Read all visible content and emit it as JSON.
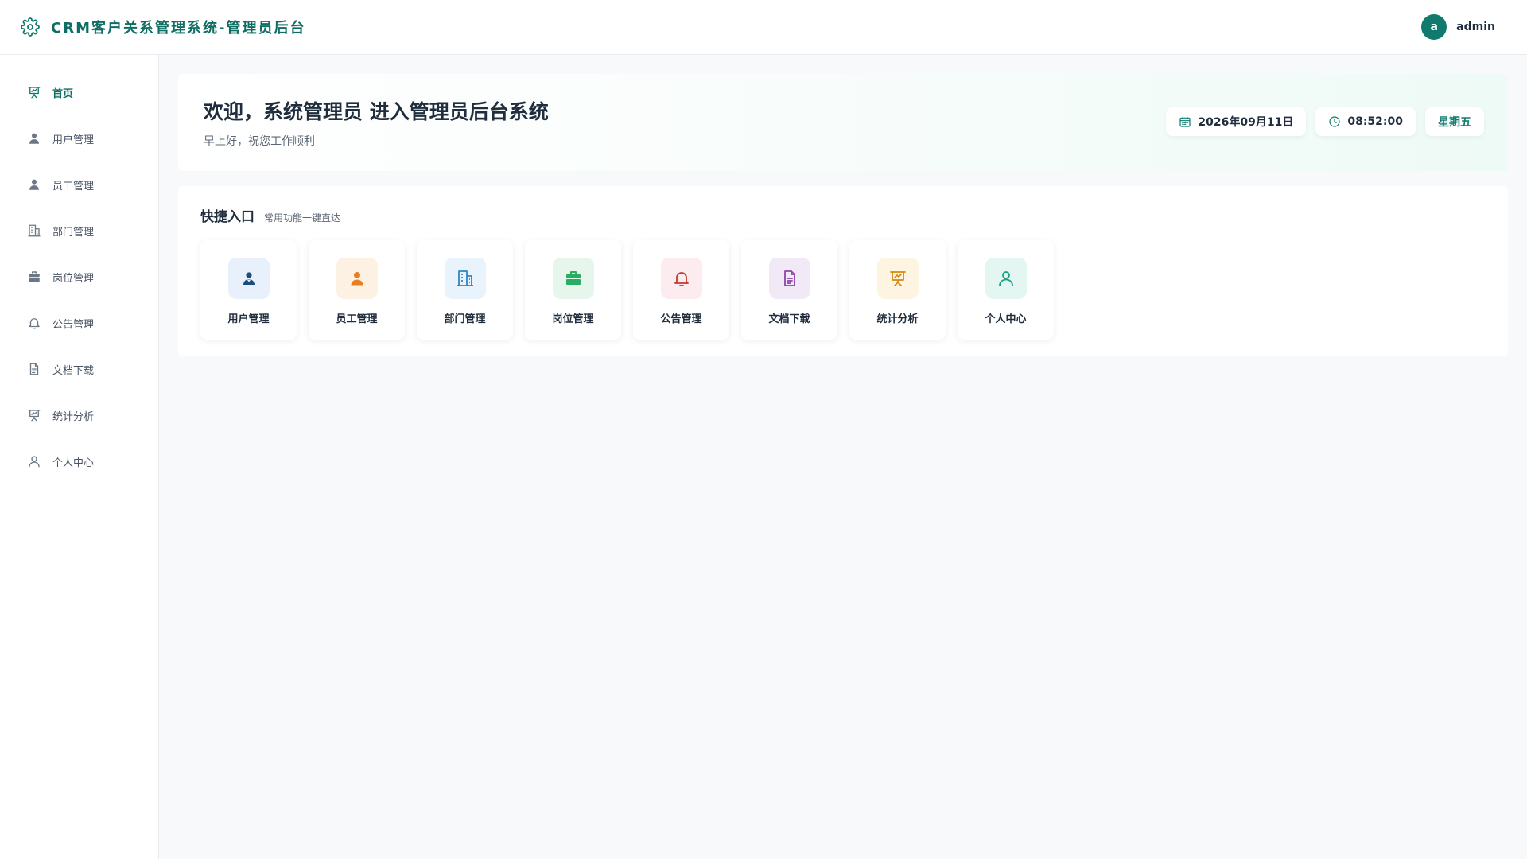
{
  "header": {
    "title": "CRM客户关系管理系统-管理员后台",
    "brand_icon": "gear-icon",
    "user": {
      "avatar_letter": "a",
      "name": "admin"
    }
  },
  "sidebar": {
    "items": [
      {
        "label": "首页",
        "icon": "presentation-chart-icon",
        "active": true
      },
      {
        "label": "用户管理",
        "icon": "user-solid-icon"
      },
      {
        "label": "员工管理",
        "icon": "user-solid-icon"
      },
      {
        "label": "部门管理",
        "icon": "building-icon"
      },
      {
        "label": "岗位管理",
        "icon": "briefcase-icon"
      },
      {
        "label": "公告管理",
        "icon": "bell-icon"
      },
      {
        "label": "文档下载",
        "icon": "document-icon"
      },
      {
        "label": "统计分析",
        "icon": "presentation-chart-icon"
      },
      {
        "label": "个人中心",
        "icon": "user-outline-icon"
      }
    ]
  },
  "welcome": {
    "title": "欢迎，系统管理员 进入管理员后台系统",
    "subtitle": "早上好，祝您工作顺利",
    "date": "2026年09月11日",
    "time": "08:52:00",
    "weekday": "星期五"
  },
  "quick": {
    "title": "快捷入口",
    "subtitle": "常用功能一键直达",
    "cards": [
      {
        "label": "用户管理",
        "icon": "user-group-icon",
        "color": "#1a4f7a",
        "bg": "#e8f1fb"
      },
      {
        "label": "员工管理",
        "icon": "user-solid-icon",
        "color": "#e67e22",
        "bg": "#fdf1e4"
      },
      {
        "label": "部门管理",
        "icon": "building-icon",
        "color": "#2e86c1",
        "bg": "#e8f3fb"
      },
      {
        "label": "岗位管理",
        "icon": "briefcase-icon",
        "color": "#27ae60",
        "bg": "#e6f6ec"
      },
      {
        "label": "公告管理",
        "icon": "bell-icon",
        "color": "#c0392b",
        "bg": "#fcecef"
      },
      {
        "label": "文档下载",
        "icon": "document-icon",
        "color": "#8e44ad",
        "bg": "#f2e9f7"
      },
      {
        "label": "统计分析",
        "icon": "presentation-chart-icon",
        "color": "#d68910",
        "bg": "#fdf5e1"
      },
      {
        "label": "个人中心",
        "icon": "user-outline-icon",
        "color": "#16a085",
        "bg": "#e4f6f1"
      }
    ]
  }
}
